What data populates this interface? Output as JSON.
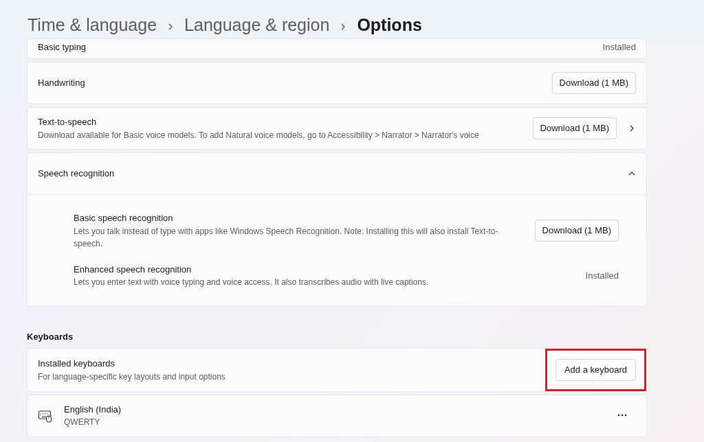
{
  "breadcrumb": [
    {
      "label": "Time & language",
      "current": false
    },
    {
      "label": "Language & region",
      "current": false
    },
    {
      "label": "Options",
      "current": true
    }
  ],
  "features": [
    {
      "kind": "status",
      "title": "Basic typing",
      "status": "Installed"
    },
    {
      "kind": "action",
      "title": "Handwriting",
      "button": "Download (1 MB)",
      "link": false
    },
    {
      "kind": "action",
      "title": "Text-to-speech",
      "description": "Download available for Basic voice models. To add Natural voice models, go to Accessibility > Narrator > Narrator's voice",
      "button": "Download (1 MB)",
      "link": true
    },
    {
      "kind": "group",
      "title": "Speech recognition",
      "expanded": true,
      "children": [
        {
          "kind": "action",
          "title": "Basic speech recognition",
          "description": "Lets you talk instead of type with apps like Windows Speech Recognition. Note: Installing this will also install Text-to-speech.",
          "button": "Download (1 MB)",
          "link": false
        },
        {
          "kind": "status",
          "title": "Enhanced speech recognition",
          "description": "Lets you enter text with voice typing and voice access. It also transcribes audio with live captions.",
          "status": "Installed"
        }
      ]
    }
  ],
  "keyboards": {
    "heading": "Keyboards",
    "installed": {
      "title": "Installed keyboards",
      "description": "For language-specific key layouts and input options",
      "button": "Add a keyboard",
      "highlighted": true
    },
    "items": [
      {
        "name": "English (India)",
        "layout": "QWERTY",
        "menu": "···"
      }
    ]
  }
}
